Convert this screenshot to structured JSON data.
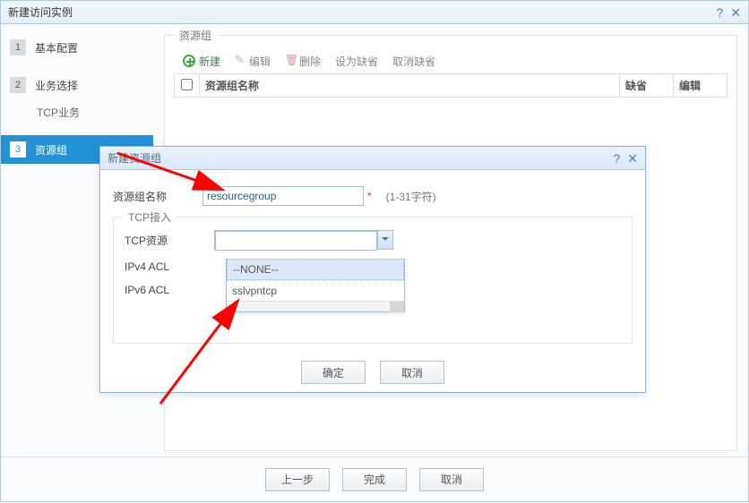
{
  "wizard": {
    "title": "新建访问实例",
    "steps": {
      "s1": {
        "num": "1",
        "label": "基本配置"
      },
      "s2": {
        "num": "2",
        "label": "业务选择"
      },
      "s2a_label": "TCP业务",
      "s3": {
        "num": "3",
        "label": "资源组"
      }
    }
  },
  "resgroup_box": {
    "legend": "资源组",
    "toolbar": {
      "new_": "新建",
      "edit": "编辑",
      "delete_": "删除",
      "set_default": "设为缺省",
      "clear_default": "取消缺省"
    },
    "columns": {
      "name": "资源组名称",
      "default_": "缺省",
      "edit": "编辑"
    }
  },
  "footer": {
    "prev": "上一步",
    "finish": "完成",
    "cancel": "取消"
  },
  "modal": {
    "title": "新建资源组",
    "name_label": "资源组名称",
    "name_value": "resourcegroup",
    "name_hint": "(1-31字符)",
    "tcp_legend": "TCP接入",
    "tcp_res_label": "TCP资源",
    "ipv4_label": "IPv4 ACL",
    "ipv6_label": "IPv6 ACL",
    "dropdown": {
      "opt_none": "--NONE--",
      "opt_sslvpntcp": "sslvpntcp"
    },
    "ok": "确定",
    "cancel": "取消"
  }
}
